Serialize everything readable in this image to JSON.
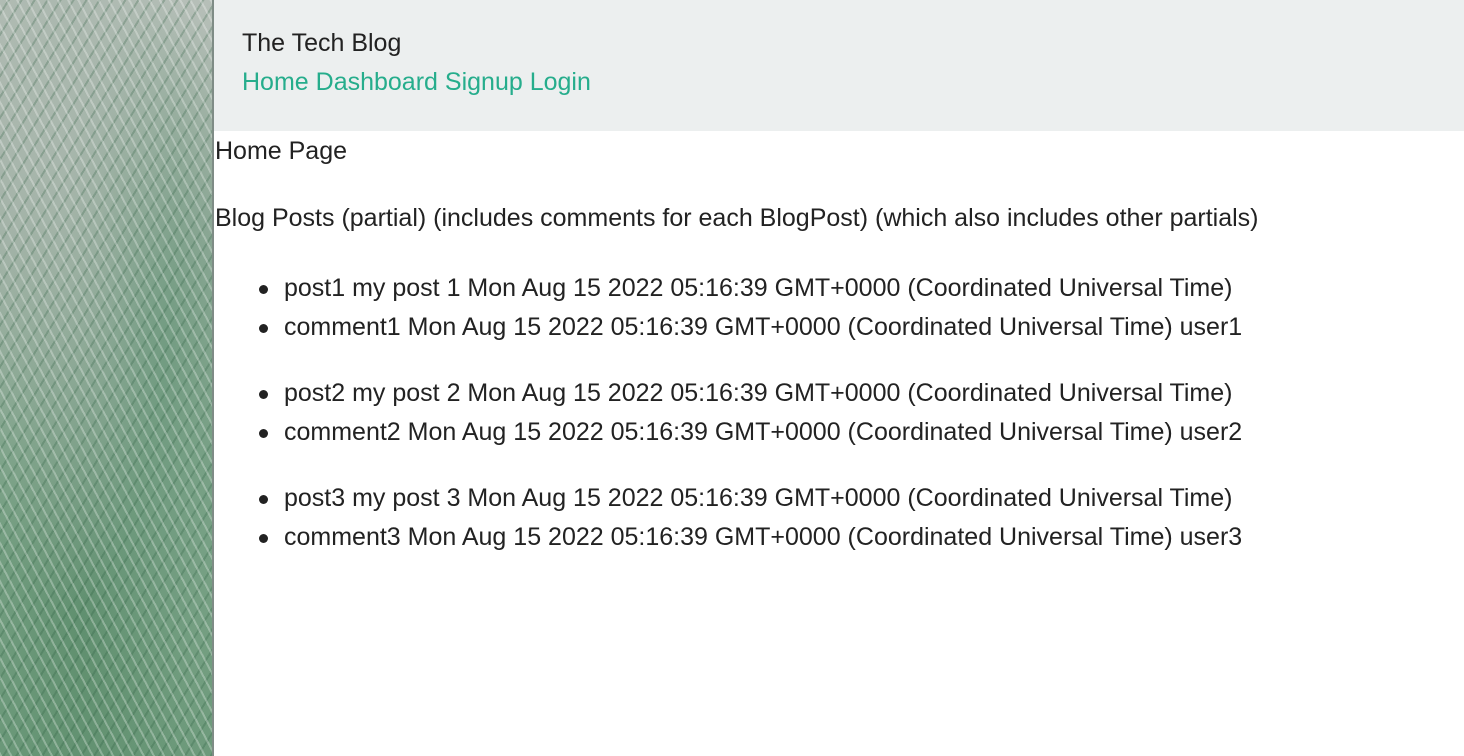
{
  "header": {
    "site_title": "The Tech Blog",
    "nav": [
      "Home",
      "Dashboard",
      "Signup",
      "Login"
    ]
  },
  "main": {
    "page_heading": "Home Page",
    "section_title": "Blog Posts (partial) (includes comments for each BlogPost) (which also includes other partials)",
    "posts": [
      {
        "post": "post1 my post 1 Mon Aug 15 2022 05:16:39 GMT+0000 (Coordinated Universal Time)",
        "comment": "comment1 Mon Aug 15 2022 05:16:39 GMT+0000 (Coordinated Universal Time) user1"
      },
      {
        "post": "post2 my post 2 Mon Aug 15 2022 05:16:39 GMT+0000 (Coordinated Universal Time)",
        "comment": "comment2 Mon Aug 15 2022 05:16:39 GMT+0000 (Coordinated Universal Time) user2"
      },
      {
        "post": "post3 my post 3 Mon Aug 15 2022 05:16:39 GMT+0000 (Coordinated Universal Time)",
        "comment": "comment3 Mon Aug 15 2022 05:16:39 GMT+0000 (Coordinated Universal Time) user3"
      }
    ]
  },
  "colors": {
    "header_bg": "#ecefef",
    "nav_link": "#26ad8c",
    "text": "#222222"
  }
}
